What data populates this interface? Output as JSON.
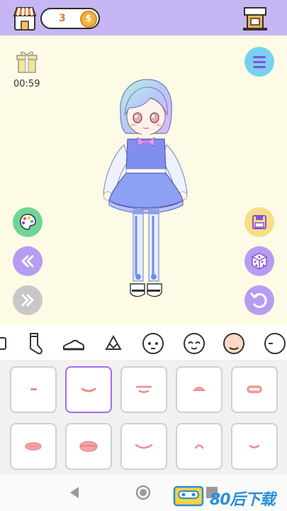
{
  "header": {
    "coins": "3",
    "coin_symbol": "$"
  },
  "stage": {
    "timer": "00:59"
  },
  "categories": [
    {
      "icon": "partial-category-icon"
    },
    {
      "icon": "sock-icon"
    },
    {
      "icon": "shoe-icon"
    },
    {
      "icon": "hat-icon"
    },
    {
      "icon": "face-neutral-icon"
    },
    {
      "icon": "face-smile-icon"
    },
    {
      "icon": "face-skin-icon"
    },
    {
      "icon": "face-partial-icon"
    }
  ],
  "selected_category": "face-skin-icon",
  "mouth_options": {
    "selected_index": 1,
    "count": 10
  },
  "watermark": {
    "text": "80后下载"
  },
  "colors": {
    "topbar": "#c6b6f3",
    "stage_bg": "#fdfbe6",
    "accent_purple": "#b79cf2",
    "selected_border": "#a46cf0",
    "menu_blue": "#7ad0f0",
    "palette_green": "#6fd596",
    "save_yellow": "#f6dd88",
    "mouth_pink": "#ef8c8c"
  }
}
